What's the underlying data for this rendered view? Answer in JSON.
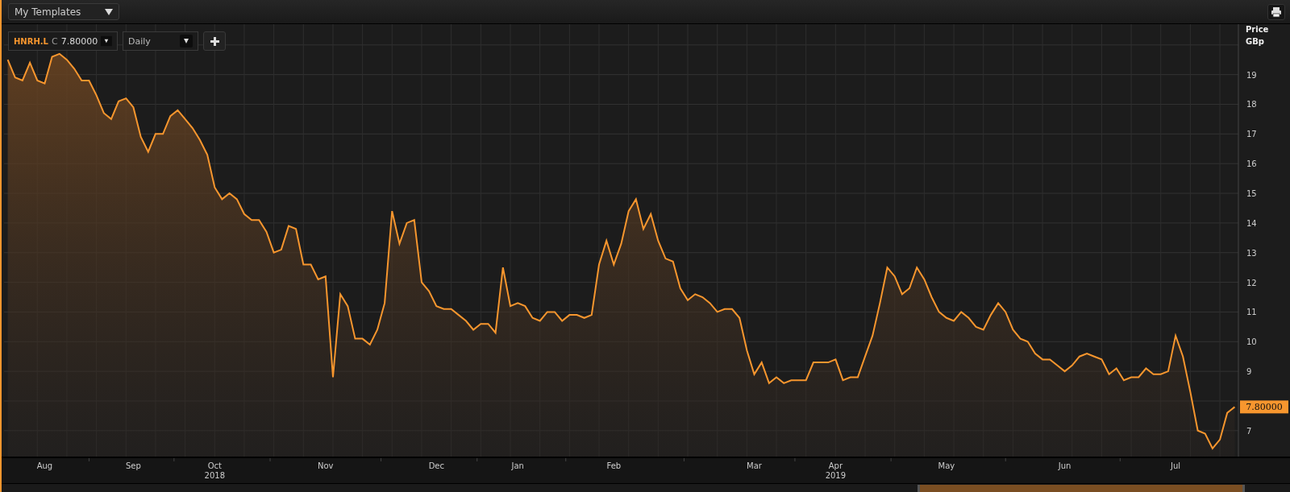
{
  "toolbar": {
    "template_dropdown": "My Templates"
  },
  "instrument": {
    "close_label": "C",
    "close_value": "7.80000"
  },
  "interval": {
    "value": "Daily"
  },
  "price_badge": "7.80000",
  "chart_data": {
    "type": "area",
    "ylabel": "Price GBp",
    "ylim": [
      6.1,
      20.7
    ],
    "grid": true,
    "categories": [
      null,
      null,
      null,
      null,
      null,
      "Aug",
      null,
      null,
      null,
      null,
      null,
      null,
      null,
      null,
      null,
      null,
      null,
      "Sep",
      null,
      null,
      null,
      null,
      null,
      null,
      null,
      null,
      null,
      null,
      "Oct\n2018",
      null,
      null,
      null,
      null,
      null,
      null,
      null,
      null,
      null,
      null,
      null,
      null,
      null,
      null,
      "Nov",
      null,
      null,
      null,
      null,
      null,
      null,
      null,
      null,
      null,
      null,
      null,
      null,
      null,
      null,
      "Dec",
      null,
      null,
      null,
      null,
      null,
      null,
      null,
      null,
      null,
      null,
      "Jan",
      null,
      null,
      null,
      null,
      null,
      null,
      null,
      null,
      null,
      null,
      null,
      null,
      "Feb",
      null,
      null,
      null,
      null,
      null,
      null,
      null,
      null,
      null,
      null,
      null,
      null,
      null,
      null,
      null,
      null,
      null,
      null,
      "Mar",
      null,
      null,
      null,
      null,
      null,
      null,
      null,
      null,
      null,
      null,
      "Apr\n2019",
      null,
      null,
      null,
      null,
      null,
      null,
      null,
      null,
      null,
      null,
      null,
      null,
      null,
      null,
      "May",
      null,
      null,
      null,
      null,
      null,
      null,
      null,
      null,
      null,
      null,
      null,
      null,
      null,
      null,
      null,
      "Jun",
      null,
      null,
      null,
      null,
      null,
      null,
      null,
      null,
      null,
      null,
      null,
      null,
      null,
      null,
      "Jul",
      null,
      null,
      null,
      null,
      null,
      null,
      null,
      null
    ],
    "yticks": [
      7,
      9,
      10,
      11,
      12,
      13,
      14,
      15,
      16,
      17,
      18,
      19
    ],
    "series": [
      {
        "name": "HNRH.L",
        "color": "#f7962e",
        "values": [
          19.5,
          18.9,
          18.8,
          19.4,
          18.8,
          18.7,
          19.6,
          19.7,
          19.5,
          19.2,
          18.8,
          18.8,
          18.3,
          17.7,
          17.5,
          18.1,
          18.2,
          17.9,
          16.9,
          16.4,
          17.0,
          17.0,
          17.6,
          17.8,
          17.5,
          17.2,
          16.8,
          16.3,
          15.2,
          14.8,
          15.0,
          14.8,
          14.3,
          14.1,
          14.1,
          13.7,
          13.0,
          13.1,
          13.9,
          13.8,
          12.6,
          12.6,
          12.1,
          12.2,
          8.8,
          11.6,
          11.2,
          10.1,
          10.1,
          9.9,
          10.4,
          11.3,
          14.4,
          13.3,
          14.0,
          14.1,
          12.0,
          11.7,
          11.2,
          11.1,
          11.1,
          10.9,
          10.7,
          10.4,
          10.6,
          10.6,
          10.3,
          12.5,
          11.2,
          11.3,
          11.2,
          10.8,
          10.7,
          11.0,
          11.0,
          10.7,
          10.9,
          10.9,
          10.8,
          10.9,
          12.6,
          13.4,
          12.6,
          13.3,
          14.4,
          14.8,
          13.8,
          14.3,
          13.4,
          12.8,
          12.7,
          11.8,
          11.4,
          11.6,
          11.5,
          11.3,
          11.0,
          11.1,
          11.1,
          10.8,
          9.7,
          8.9,
          9.3,
          8.6,
          8.8,
          8.6,
          8.7,
          8.7,
          8.7,
          9.3,
          9.3,
          9.3,
          9.4,
          8.7,
          8.8,
          8.8,
          9.5,
          10.2,
          11.3,
          12.5,
          12.2,
          11.6,
          11.8,
          12.5,
          12.1,
          11.5,
          11.0,
          10.8,
          10.7,
          11.0,
          10.8,
          10.5,
          10.4,
          10.9,
          11.3,
          11.0,
          10.4,
          10.1,
          10.0,
          9.6,
          9.4,
          9.4,
          9.2,
          9.0,
          9.2,
          9.5,
          9.6,
          9.5,
          9.4,
          8.9,
          9.1,
          8.7,
          8.8,
          8.8,
          9.1,
          8.9,
          8.9,
          9.0,
          10.2,
          9.5,
          8.3,
          7.0,
          6.9,
          6.4,
          6.7,
          7.6,
          7.8
        ]
      }
    ]
  }
}
